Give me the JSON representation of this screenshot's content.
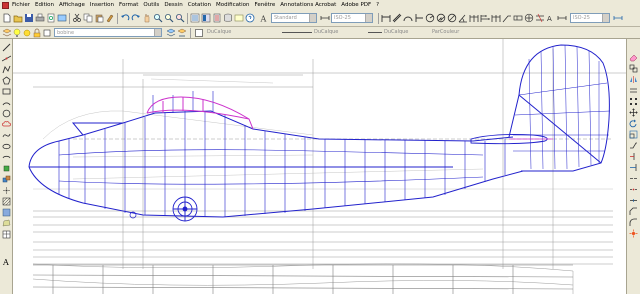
{
  "menu": {
    "items": [
      "Fichier",
      "Edition",
      "Affichage",
      "Insertion",
      "Format",
      "Outils",
      "Dessin",
      "Cotation",
      "Modification",
      "Fenêtre",
      "Annotations Acrobat",
      "Adobe PDF",
      "?"
    ]
  },
  "toolbar": {
    "text_style": "Standard",
    "dim_style_1": "ISO-25",
    "dim_style_2": "ISO-25"
  },
  "properties": {
    "layer_name": "bobine",
    "color": "DuCalque",
    "linetype": "DuCalque",
    "lineweight": "DuCalque",
    "plot_style": "ParCouleur"
  },
  "left_tools": [
    "line-icon",
    "construction-line-icon",
    "polyline-icon",
    "polygon-icon",
    "rectangle-icon",
    "arc-icon",
    "circle-icon",
    "revision-cloud-icon",
    "spline-icon",
    "ellipse-icon",
    "ellipse-arc-icon",
    "insert-block-icon",
    "make-block-icon",
    "point-icon",
    "hatch-icon",
    "gradient-icon",
    "region-icon",
    "table-icon",
    "mtext-icon"
  ],
  "right_tools": [
    "erase-icon",
    "copy-icon",
    "mirror-icon",
    "offset-icon",
    "array-icon",
    "move-icon",
    "rotate-icon",
    "scale-icon",
    "stretch-icon",
    "trim-icon",
    "extend-icon",
    "break-point-icon",
    "break-icon",
    "join-icon",
    "chamfer-icon",
    "fillet-icon",
    "explode-icon"
  ],
  "canvas": {
    "text_tool_label": "A",
    "colors": {
      "structure": "#2222cc",
      "canopy": "#cc33cc",
      "scan": "#808080"
    }
  }
}
